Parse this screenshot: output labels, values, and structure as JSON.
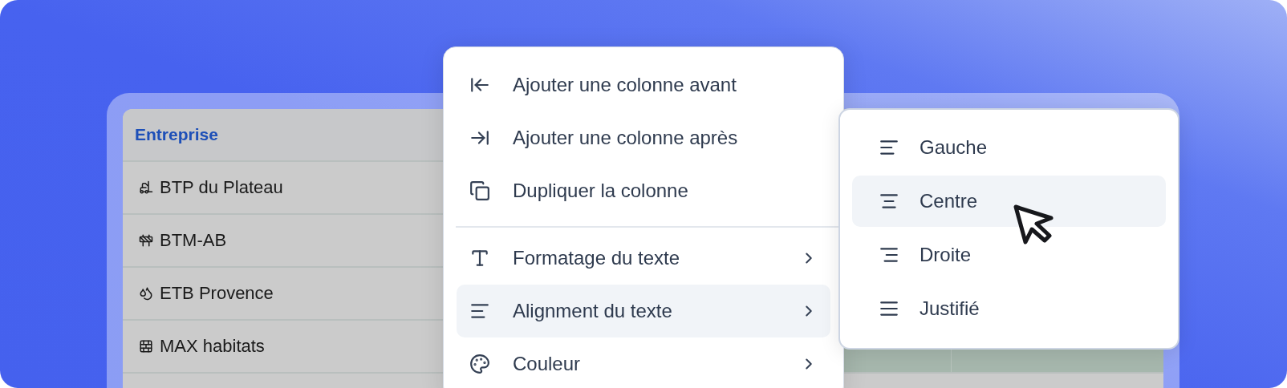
{
  "table": {
    "header": "Entreprise",
    "rows": [
      {
        "name": "BTP du Plateau"
      },
      {
        "name": "BTM-AB"
      },
      {
        "name": "ETB Provence"
      },
      {
        "name": "MAX habitats",
        "highlighted": true
      }
    ]
  },
  "context_menu": {
    "items": [
      {
        "kind": "item",
        "label": "Ajouter une colonne avant",
        "has_submenu": false,
        "selected": false
      },
      {
        "kind": "item",
        "label": "Ajouter une colonne après",
        "has_submenu": false,
        "selected": false
      },
      {
        "kind": "item",
        "label": "Dupliquer la colonne",
        "has_submenu": false,
        "selected": false
      },
      {
        "kind": "separator"
      },
      {
        "kind": "item",
        "label": "Formatage du texte",
        "has_submenu": true,
        "selected": false
      },
      {
        "kind": "item",
        "label": "Alignment du texte",
        "has_submenu": true,
        "selected": true
      },
      {
        "kind": "item",
        "label": "Couleur",
        "has_submenu": true,
        "selected": false
      }
    ]
  },
  "submenu": {
    "items": [
      {
        "label": "Gauche",
        "selected": false
      },
      {
        "label": "Centre",
        "selected": true
      },
      {
        "label": "Droite",
        "selected": false
      },
      {
        "label": "Justifié",
        "selected": false
      }
    ]
  }
}
